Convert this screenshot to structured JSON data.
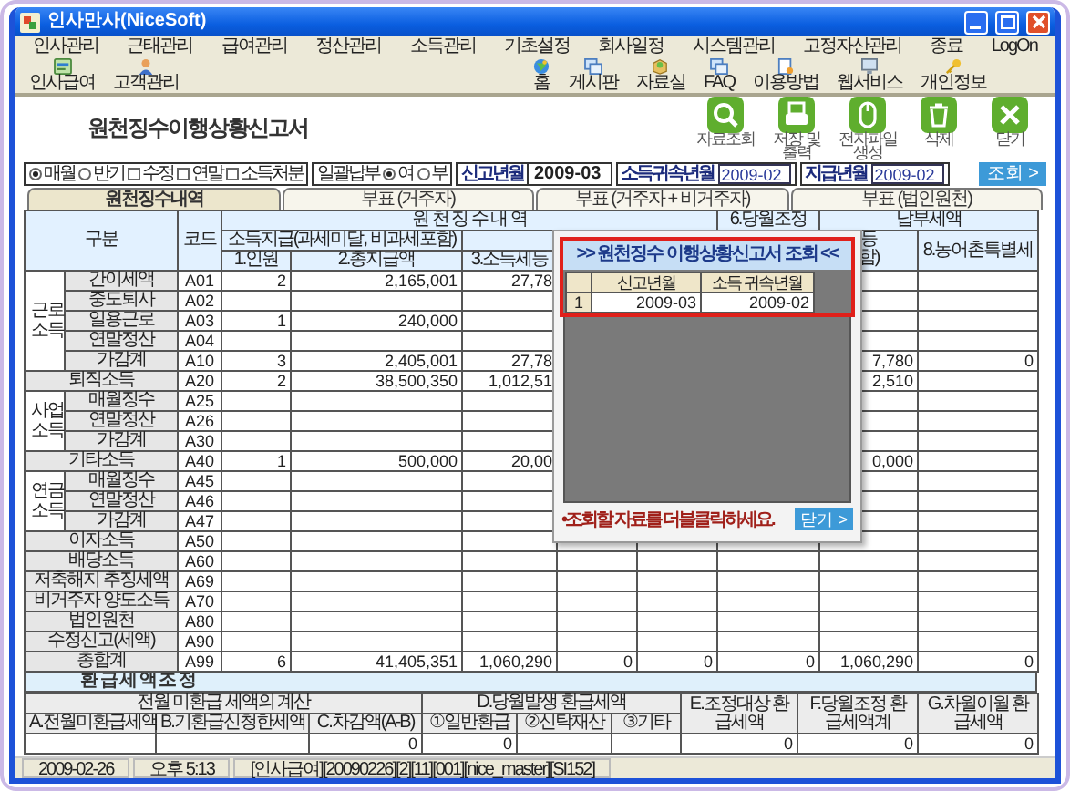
{
  "window": {
    "title": "인사만사(NiceSoft)"
  },
  "menu": [
    "인사관리",
    "근태관리",
    "급여관리",
    "정산관리",
    "소득관리",
    "기초설정",
    "회사일정",
    "시스템관리",
    "고정자산관리",
    "종료",
    "LogOn"
  ],
  "toolbar_left": [
    "인사급여",
    "고객관리"
  ],
  "toolbar_right": [
    "홈",
    "게시판",
    "자료실",
    "FAQ",
    "이용방법",
    "웹서비스",
    "개인정보"
  ],
  "page_title": "원천징수이행상황신고서",
  "actions": [
    "자료조회",
    "저장 및출력",
    "전자파일 생성",
    "삭제",
    "닫기"
  ],
  "filter": {
    "period": [
      {
        "kind": "radio",
        "label": "매월",
        "selected": true
      },
      {
        "kind": "radio",
        "label": "반기",
        "selected": false
      },
      {
        "kind": "checkbox",
        "label": "수정",
        "checked": false
      },
      {
        "kind": "checkbox",
        "label": "연말",
        "checked": false
      },
      {
        "kind": "checkbox",
        "label": "소득처분",
        "checked": false
      }
    ],
    "lump_sum": {
      "label": "일괄납부",
      "options": [
        {
          "label": "여",
          "selected": true
        },
        {
          "label": "부",
          "selected": false
        }
      ]
    },
    "report_month": {
      "label": "신고년월",
      "value": "2009-03"
    },
    "income_month": {
      "label": "소득귀속년월",
      "value": "2009-02"
    },
    "pay_month": {
      "label": "지급년월",
      "value": "2009-02"
    },
    "search_button": "조회 >"
  },
  "tabs": [
    {
      "label": "원천징수내역",
      "selected": true
    },
    {
      "label": "부표 (거주자)",
      "selected": false
    },
    {
      "label": "부표 (거주자 + 비거주자)",
      "selected": false
    },
    {
      "label": "부표 (법인원천)",
      "selected": false
    }
  ],
  "table": {
    "headers": {
      "category": "구분",
      "code": "코드",
      "withholding": "원 천 징 수 내 역",
      "adjust": "6.당월조정",
      "payment": "납부세액",
      "income_paid": "소득지급(과세미달, 비과세포함)",
      "col_7": [
        "등",
        "함)"
      ],
      "rural_tax": "8.농어촌특별세",
      "count": "1.인원",
      "total_paid": "2.총지급액",
      "tax": "3.소득세등"
    },
    "rows": [
      {
        "kind": "group",
        "label": "근로소득",
        "items": [
          {
            "label": "간이세액",
            "code": "A01",
            "cells": {
              "count": "2",
              "total_paid": "2,165,001",
              "tax": "27,78"
            }
          },
          {
            "label": "중도퇴사",
            "code": "A02"
          },
          {
            "label": "일용근로",
            "code": "A03",
            "cells": {
              "count": "1",
              "total_paid": "240,000"
            }
          },
          {
            "label": "연말정산",
            "code": "A04"
          },
          {
            "label": "가감계",
            "code": "A10",
            "cells": {
              "count": "3",
              "total_paid": "2,405,001",
              "tax": "27,78",
              "col_7": "7,780",
              "rural_tax": "0"
            }
          }
        ]
      },
      {
        "kind": "single",
        "label": "퇴직소득",
        "code": "A20",
        "cells": {
          "count": "2",
          "total_paid": "38,500,350",
          "tax": "1,012,51",
          "col_7": "2,510"
        }
      },
      {
        "kind": "group",
        "label": "사업소득",
        "items": [
          {
            "label": "매월징수",
            "code": "A25"
          },
          {
            "label": "연말정산",
            "code": "A26"
          },
          {
            "label": "가감계",
            "code": "A30"
          }
        ]
      },
      {
        "kind": "single",
        "label": "기타소득",
        "code": "A40",
        "cells": {
          "count": "1",
          "total_paid": "500,000",
          "tax": "20,00",
          "col_7": "0,000"
        }
      },
      {
        "kind": "group",
        "label": "연금소득",
        "items": [
          {
            "label": "매월징수",
            "code": "A45"
          },
          {
            "label": "연말정산",
            "code": "A46"
          },
          {
            "label": "가감계",
            "code": "A47"
          }
        ]
      },
      {
        "kind": "single",
        "label": "이자소득",
        "code": "A50"
      },
      {
        "kind": "single",
        "label": "배당소득",
        "code": "A60"
      },
      {
        "kind": "single",
        "label": "저축해지 추징세액",
        "code": "A69"
      },
      {
        "kind": "single",
        "label": "비거주자 양도소득",
        "code": "A70"
      },
      {
        "kind": "single",
        "label": "법인원천",
        "code": "A80"
      },
      {
        "kind": "single",
        "label": "수정신고(세액)",
        "code": "A90"
      },
      {
        "kind": "single",
        "label": "총합계",
        "code": "A99",
        "cells": {
          "count": "6",
          "total_paid": "41,405,351",
          "tax": "1,060,290",
          "col_4": "0",
          "col_5": "0",
          "adjust": "0",
          "col_7": "1,060,290",
          "rural_tax": "0"
        }
      }
    ]
  },
  "dialog": {
    "title": ">> 원천징수 이행상황신고서 조회 <<",
    "columns": [
      "신고년월",
      "소득 귀속년월"
    ],
    "rows": [
      {
        "number": "1",
        "cells": [
          "2009-03",
          "2009-02"
        ]
      }
    ],
    "hint": "•조회할 자료를 더블클릭하세요.",
    "close_button": "닫기 >"
  },
  "refund": {
    "title": "환 급 세 액 조 정",
    "groups": [
      "전월 미환급 세액의 계산",
      "D.당월발생 환급세액"
    ],
    "columns": [
      "A.전월미환급세액",
      "B.기환급신청한세액",
      "C.차감액(A-B)",
      "①일반환급",
      "②신탁재산",
      "③기타"
    ],
    "side_columns": [
      "E.조정대상 환급세액",
      "F.당월조정 환급세액계",
      "G.차월이월 환급세액"
    ],
    "values": {
      "c": "0",
      "d1": "0",
      "e": "0",
      "f": "0",
      "g": "0"
    }
  },
  "status_bar": [
    "2009-02-26",
    "오후 5:13",
    "[인사급여][20090226][2][11][001][nice_master][SI152]"
  ]
}
